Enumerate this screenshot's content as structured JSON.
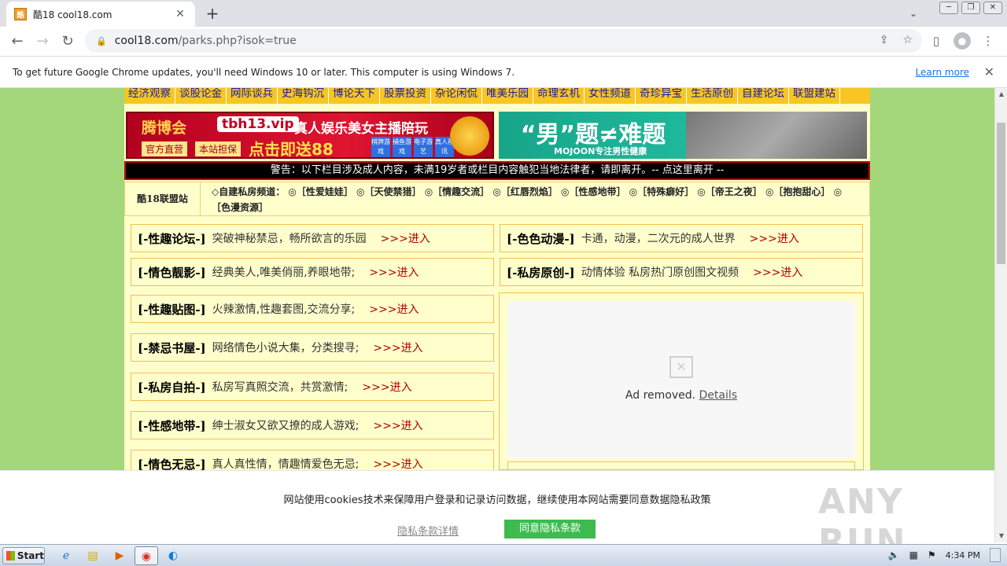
{
  "browser": {
    "tab_title": "酷18 cool18.com",
    "favicon_text": "酷",
    "url_host": "cool18.com",
    "url_path": "/parks.php?isok=true"
  },
  "infobar": {
    "message": "To get future Google Chrome updates, you'll need Windows 10 or later. This computer is using Windows 7.",
    "learn_more": "Learn more"
  },
  "page": {
    "nav_links": [
      "经济观察",
      "谈股论金",
      "网际谈兵",
      "史海钩沉",
      "博论天下",
      "股票投资",
      "杂论闲侃",
      "唯美乐园",
      "命理玄机",
      "女性频道",
      "奇珍异宝",
      "生活原创",
      "自建论坛",
      "联盟建站"
    ],
    "banner1": {
      "brand": "腾博会",
      "url": "tbh13.vip",
      "slogan": "真人娱乐美女主播陪玩",
      "tag1": "官方直营",
      "tag2": "本站担保",
      "cta": "点击即送88",
      "chips": [
        "棋牌游戏",
        "捕鱼游戏",
        "电子游艺",
        "真人视讯"
      ]
    },
    "banner2": {
      "headline": "“男”题≠难题",
      "sub": "MOJOON专注男性健康"
    },
    "warning": "警告：以下栏目涉及成人内容，未满19岁者或栏目内容触犯当地法律者，请即离开。-- 点这里离开 --",
    "alliance_label": "酷18联盟站",
    "alliance_text": "◇自建私房频道： ◎［性爱娃娃］ ◎［天使禁猎］ ◎［情趣交流］ ◎［红唇烈焰］ ◎［性感地带］ ◎［特殊癖好］ ◎［帝王之夜］ ◎［抱抱甜心］ ◎［色漫资源］",
    "enter_label": ">>>进入",
    "left_sections": [
      {
        "title": "[-性趣论坛-]",
        "desc": "突破神秘禁忌，畅所欲言的乐园"
      },
      {
        "title": "[-情色靓影-]",
        "desc": "经典美人,唯美俏丽,养眼地带;"
      },
      {
        "title": "[-性趣贴图-]",
        "desc": "火辣激情,性趣套图,交流分享;"
      },
      {
        "title": "[-禁忌书屋-]",
        "desc": "网络情色小说大集，分类搜寻;"
      },
      {
        "title": "[-私房自拍-]",
        "desc": "私房写真照交流，共赏激情;"
      },
      {
        "title": "[-性感地带-]",
        "desc": "绅士淑女又欲又撩的成人游戏;"
      },
      {
        "title": "[-情色无忌-]",
        "desc": "真人真性情，情趣情爱色无忌;"
      }
    ],
    "right_sections": [
      {
        "title": "[-色色动漫-]",
        "desc": "卡通，动漫，二次元的成人世界"
      },
      {
        "title": "[-私房原创-]",
        "desc": "动情体验 私房热门原创图文视频"
      }
    ],
    "ad_removed": "Ad removed.",
    "ad_details": "Details"
  },
  "cookie": {
    "text": "网站使用cookies技术来保障用户登录和记录访问数据，继续使用本网站需要同意数据隐私政策",
    "details": "隐私条款详情",
    "agree": "同意隐私条款"
  },
  "watermark": "ANY RUN",
  "taskbar": {
    "start": "Start",
    "clock": "4:34 PM"
  }
}
